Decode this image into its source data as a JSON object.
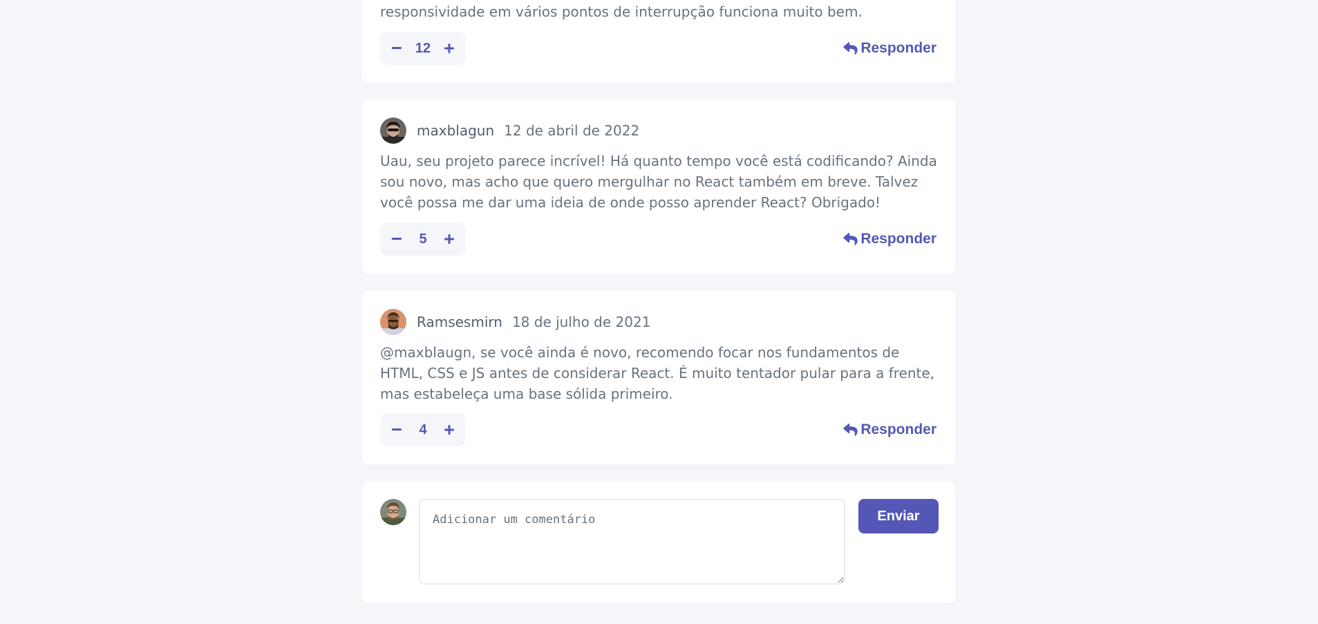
{
  "colors": {
    "page_background": "#f5f6fa",
    "card_background": "#ffffff",
    "accent": "#5457b6",
    "body_text": "#67727e",
    "username_text": "#334253"
  },
  "icons": {
    "minus": "minus-icon",
    "plus": "plus-icon",
    "reply": "reply-icon"
  },
  "comments": [
    {
      "content": "responsividade em vários pontos de interrupção funciona muito bem.",
      "score": "12",
      "reply_label": "Responder"
    },
    {
      "username": "maxblagun",
      "date": "12 de abril de 2022",
      "content": "Uau, seu projeto parece incrível! Há quanto tempo você está codificando? Ainda sou novo, mas acho que quero mergulhar no React também em breve. Talvez você possa me dar uma ideia de onde posso aprender React? Obrigado!",
      "score": "5",
      "reply_label": "Responder"
    },
    {
      "username": "Ramsesmirn",
      "date": "18 de julho de 2021",
      "content": "@maxblaugn, se você ainda é novo, recomendo focar nos fundamentos de HTML, CSS e JS antes de considerar React. É muito tentador pular para a frente, mas estabeleça uma base sólida primeiro.",
      "score": "4",
      "reply_label": "Responder"
    }
  ],
  "composer": {
    "placeholder": "Adicionar um comentário",
    "value": "",
    "send_label": "Enviar"
  }
}
